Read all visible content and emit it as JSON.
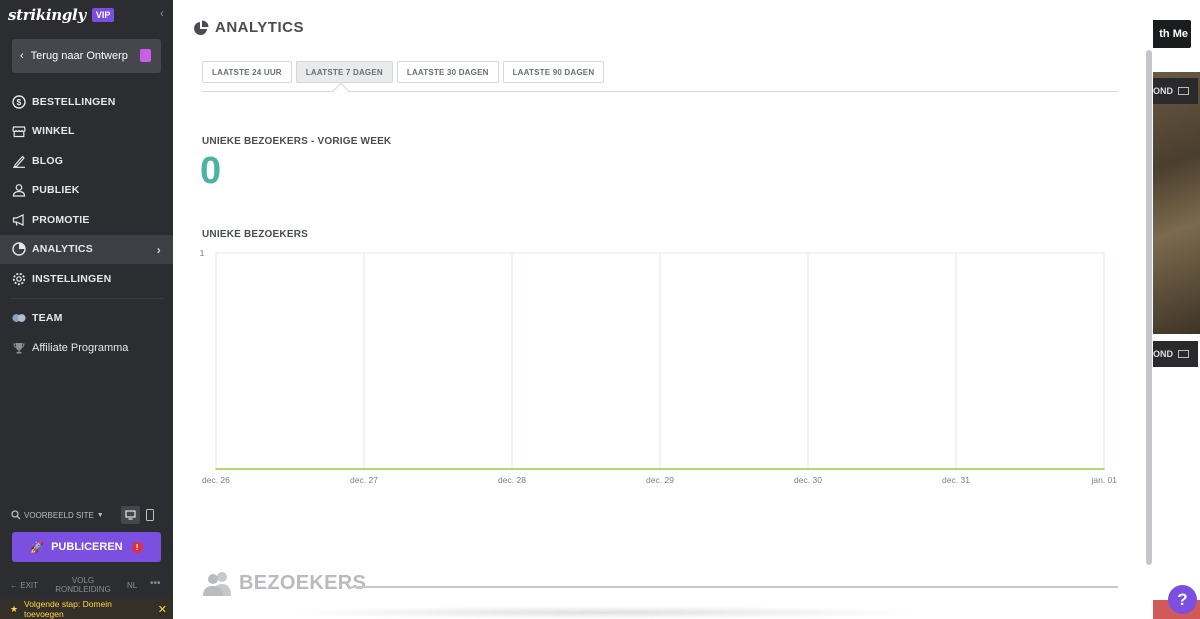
{
  "sidebar": {
    "brand": "strikingly",
    "badge": "VIP",
    "back_button": "Terug naar Ontwerp",
    "nav": [
      {
        "label": "BESTELLINGEN",
        "icon": "dollar-circle-icon"
      },
      {
        "label": "WINKEL",
        "icon": "store-icon"
      },
      {
        "label": "BLOG",
        "icon": "pen-icon"
      },
      {
        "label": "PUBLIEK",
        "icon": "audience-icon"
      },
      {
        "label": "PROMOTIE",
        "icon": "megaphone-icon"
      },
      {
        "label": "ANALYTICS",
        "icon": "pie-chart-icon",
        "active": true
      },
      {
        "label": "INSTELLINGEN",
        "icon": "gear-icon"
      },
      {
        "label": "TEAM",
        "icon": "team-icon"
      },
      {
        "label": "Affiliate Programma",
        "icon": "trophy-icon"
      }
    ],
    "preview_label": "VOORBEELD SITE",
    "publish_label": "PUBLICEREN",
    "publish_alert": "!",
    "exit_label": "EXIT",
    "tour_label": "VOLG RONDLEIDING",
    "language": "NL",
    "more": "•••",
    "next_step": "Volgende stap: Domein toevoegen"
  },
  "main": {
    "title": "ANALYTICS",
    "tabs": [
      "LAATSTE 24 UUR",
      "LAATSTE 7 DAGEN",
      "LAATSTE 30 DAGEN",
      "LAATSTE 90 DAGEN"
    ],
    "active_tab": 1,
    "unique_last_week_label": "UNIEKE BEZOEKERS - VORIGE WEEK",
    "unique_last_week_value": "0",
    "chart_title": "UNIEKE BEZOEKERS",
    "visitors_section": "BEZOEKERS"
  },
  "chart_data": {
    "type": "line",
    "title": "UNIEKE BEZOEKERS",
    "x": [
      "dec. 26",
      "dec. 27",
      "dec. 28",
      "dec. 29",
      "dec. 30",
      "dec. 31",
      "jan. 01"
    ],
    "series": [
      {
        "values": [
          0,
          0,
          0,
          0,
          0,
          0,
          0
        ],
        "color": "#9ccc3c"
      }
    ],
    "y_ticks": [
      "1"
    ],
    "ylim": [
      0,
      1
    ],
    "grid": true
  },
  "right_preview": {
    "button_text": "th Me",
    "bg_label_1": "OND",
    "bg_label_2": "OND"
  },
  "help_label": "?",
  "colors": {
    "sidebar_bg": "#2c2d30",
    "accent_purple": "#7b4fe0",
    "zero_teal": "#4ab3a4",
    "line_green": "#9ccc3c"
  }
}
